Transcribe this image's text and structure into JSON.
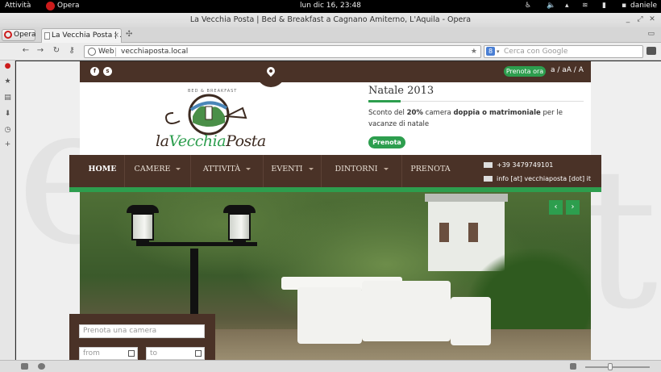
{
  "system": {
    "activities": "Attività",
    "app": "Opera",
    "clock": "lun dic 16, 23:48",
    "user": "daniele"
  },
  "window": {
    "title": "La Vecchia Posta | Bed & Breakfast a Cagnano Amiterno, L'Aquila - Opera"
  },
  "tabs": {
    "menu_label": "Opera",
    "active_tab": "La Vecchia Posta | ..."
  },
  "address": {
    "badge": "Web",
    "url": "vecchiaposta.local",
    "search_placeholder": "Cerca con Google"
  },
  "site": {
    "prenota_pill": "Prenota ora",
    "font_sizes": "a / aA / A",
    "logo_text_a": "la",
    "logo_text_b": "Vecchia",
    "logo_text_c": "Posta",
    "logo_sub": "BED & BREAKFAST",
    "news": {
      "title": "Natale 2013",
      "text_1": "Sconto del ",
      "text_pct": "20%",
      "text_2": " camera ",
      "text_3": "doppia o ",
      "text_4": "matrimoniale",
      "text_5": " per le vacanze di natale",
      "button": "Prenota"
    },
    "nav": {
      "home": "HOME",
      "camere": "CAMERE",
      "attivita": "ATTIVITÀ",
      "eventi": "EVENTI",
      "dintorni": "DINTORNI",
      "prenota": "PRENOTA"
    },
    "contact": {
      "phone": "+39 3479749101",
      "email": "info [at] vecchiaposta [dot] it"
    },
    "booking": {
      "placeholder": "Prenota una camera",
      "from": "from",
      "to": "to"
    }
  },
  "colors": {
    "brown": "#4a3227",
    "green": "#2d9e4e"
  }
}
